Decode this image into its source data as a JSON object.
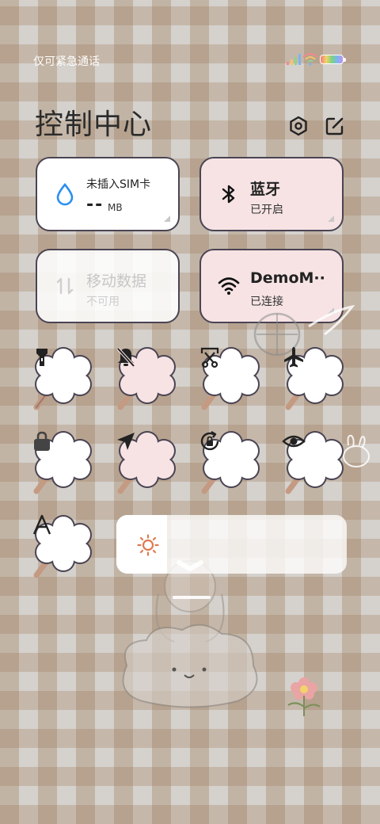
{
  "status_bar": {
    "carrier_text": "仅可紧急通话"
  },
  "header": {
    "title": "控制中心",
    "settings_icon": "gear-hex-icon",
    "edit_icon": "edit-icon"
  },
  "tiles": {
    "data_usage": {
      "title": "未插入SIM卡",
      "value": "--",
      "unit": "MB",
      "icon": "water-drop-icon"
    },
    "bluetooth": {
      "title": "蓝牙",
      "status": "已开启",
      "icon": "bluetooth-icon"
    },
    "mobile_data": {
      "title": "移动数据",
      "status": "不可用",
      "icon": "data-arrows-icon"
    },
    "wifi": {
      "title": "DemoM··",
      "status": "已连接",
      "icon": "wifi-icon"
    }
  },
  "toggles": [
    {
      "name": "flashlight",
      "icon": "flashlight-icon",
      "active": false
    },
    {
      "name": "mute",
      "icon": "bell-off-icon",
      "active": true
    },
    {
      "name": "screenshot",
      "icon": "scissors-icon",
      "active": false
    },
    {
      "name": "airplane",
      "icon": "airplane-icon",
      "active": false
    },
    {
      "name": "lock-screen",
      "icon": "lock-icon",
      "active": false
    },
    {
      "name": "location",
      "icon": "location-arrow-icon",
      "active": true
    },
    {
      "name": "auto-rotate",
      "icon": "rotate-lock-icon",
      "active": false
    },
    {
      "name": "reading-mode",
      "icon": "eye-icon",
      "active": false
    },
    {
      "name": "font",
      "icon": "font-a-icon",
      "active": false
    }
  ],
  "brightness": {
    "level_percent": 22,
    "icon": "sun-icon"
  },
  "colors": {
    "tile_border": "#4a4453",
    "active_pink": "#f7e3e4",
    "sun": "#e07a4f"
  }
}
